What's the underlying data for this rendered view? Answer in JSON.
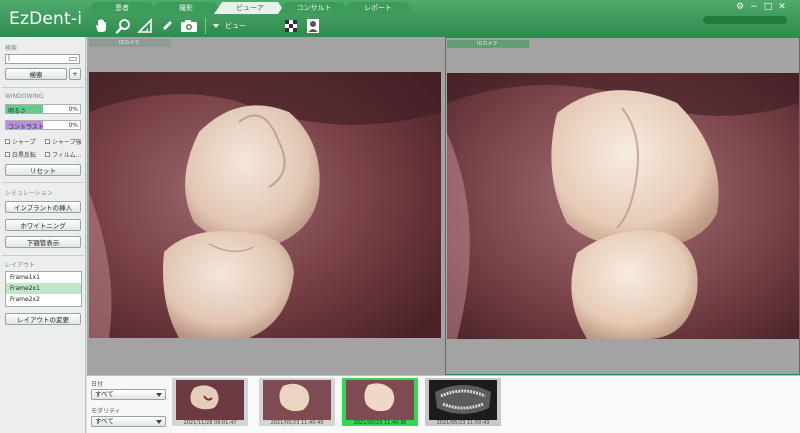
{
  "app": {
    "logo": "EzDent-i"
  },
  "tabs": [
    {
      "label": "患者"
    },
    {
      "label": "撮影"
    },
    {
      "label": "ビューア",
      "active": true
    },
    {
      "label": "コンサルト"
    },
    {
      "label": "レポート"
    }
  ],
  "toolbar": {
    "view_label": "ビュー"
  },
  "window_controls": {
    "settings": "⚙",
    "minimize": "−",
    "maximize": "□",
    "close": "✕"
  },
  "left": {
    "search": {
      "title": "検索",
      "value": "|",
      "button": "検索",
      "plus": "+"
    },
    "windowing": {
      "title": "WINDOWING",
      "brightness": {
        "label": "明るさ",
        "value": "0%",
        "fill": 0.5
      },
      "contrast": {
        "label": "コントラスト",
        "value": "0%",
        "fill": 0.5
      },
      "sharp": "シャープ",
      "sharp_strong": "シャープ強",
      "invert": "白黒反転",
      "filter": "フィルム...",
      "reset": "リセット"
    },
    "simulation": {
      "title": "シミュレーション",
      "implant": "インプラントの挿入",
      "whitening": "ホワイトニング",
      "nerve": "下顎管表示"
    },
    "layout": {
      "title": "レイアウト",
      "items": [
        "Frame1x1",
        "Frame2x1",
        "Frame2x2"
      ],
      "selected_index": 1,
      "change": "レイアウトの変更"
    }
  },
  "viewer": {
    "left_pane": {
      "title": "IOカメラ"
    },
    "right_pane": {
      "title": "IOカメラ"
    }
  },
  "bottom": {
    "date_label": "日付",
    "date_value": "すべて",
    "modality_label": "モダリティ",
    "modality_value": "すべて",
    "thumbs": [
      {
        "date": "2021/11/28 09:01:47",
        "kind": "intraoral"
      },
      {
        "date": "2021/05/23 11:40:45",
        "kind": "intraoral"
      },
      {
        "date": "2021/05/23 11:40:36",
        "kind": "intraoral",
        "selected": true
      },
      {
        "date": "2021/05/23 11:50:43",
        "kind": "xray"
      }
    ]
  },
  "colors": {
    "brand_green": "#3a9a58",
    "brightness_fill": "#66c88a",
    "contrast_fill": "#b98ee0",
    "selected_thumb": "#35d654"
  }
}
